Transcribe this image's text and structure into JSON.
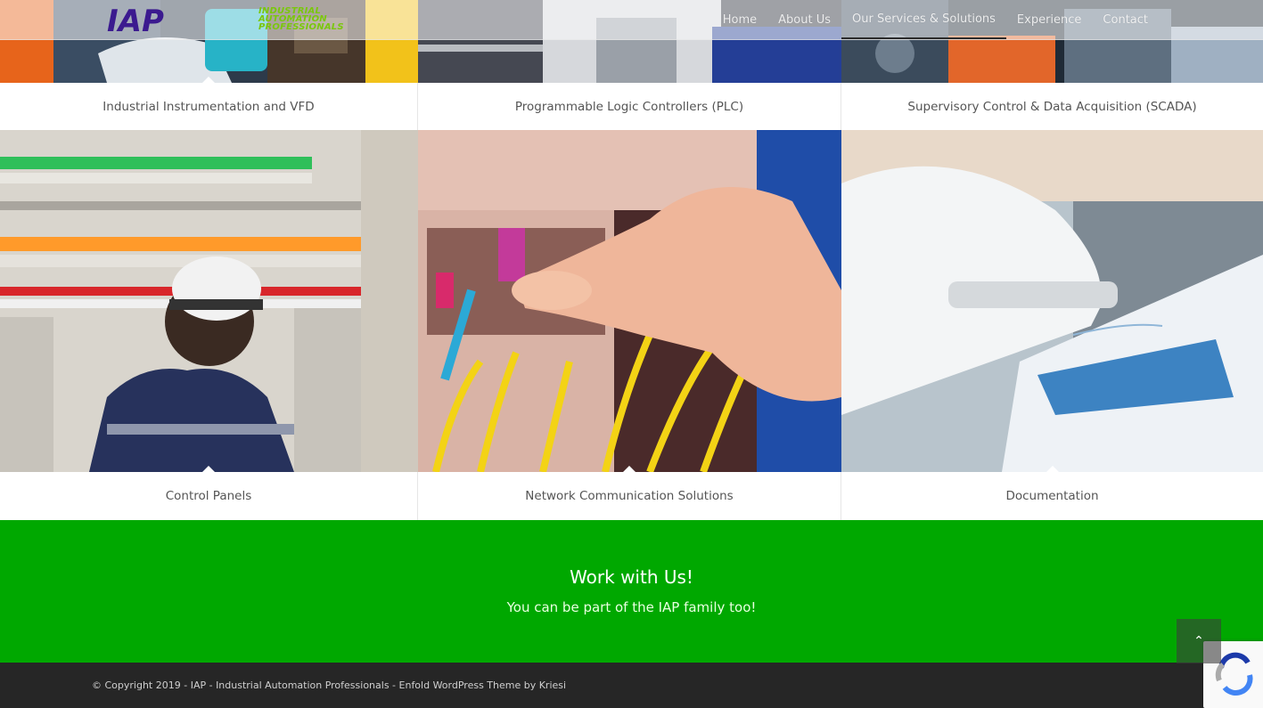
{
  "header": {
    "logo_mark": "IAP",
    "logo_line1": "INDUSTRIAL",
    "logo_line2": "AUTOMATION",
    "logo_line3": "PROFESSIONALS",
    "nav": [
      {
        "label": "Home"
      },
      {
        "label": "About Us"
      },
      {
        "label": "Our Services & Solutions"
      },
      {
        "label": "Experience"
      },
      {
        "label": "Contact"
      }
    ]
  },
  "services": [
    {
      "label": "Industrial Instrumentation and VFD"
    },
    {
      "label": "Programmable Logic Controllers (PLC)"
    },
    {
      "label": "Supervisory Control & Data Acquisition (SCADA)"
    },
    {
      "label": "Control Panels"
    },
    {
      "label": "Network Communication Solutions"
    },
    {
      "label": "Documentation"
    }
  ],
  "cta": {
    "title": "Work with Us!",
    "subtitle": "You can be part of the IAP family too!"
  },
  "footer": {
    "copyright": "© Copyright 2019 - IAP - Industrial Automation Professionals - ",
    "theme_link": "Enfold WordPress Theme by Kriesi"
  },
  "scroll_top": {
    "icon": "chevron-up-icon",
    "glyph": "⌃"
  },
  "colors": {
    "brand_purple": "#3b1a8f",
    "brand_green": "#7ac70c",
    "cta_green": "#00a800",
    "footer_bg": "#262626"
  }
}
